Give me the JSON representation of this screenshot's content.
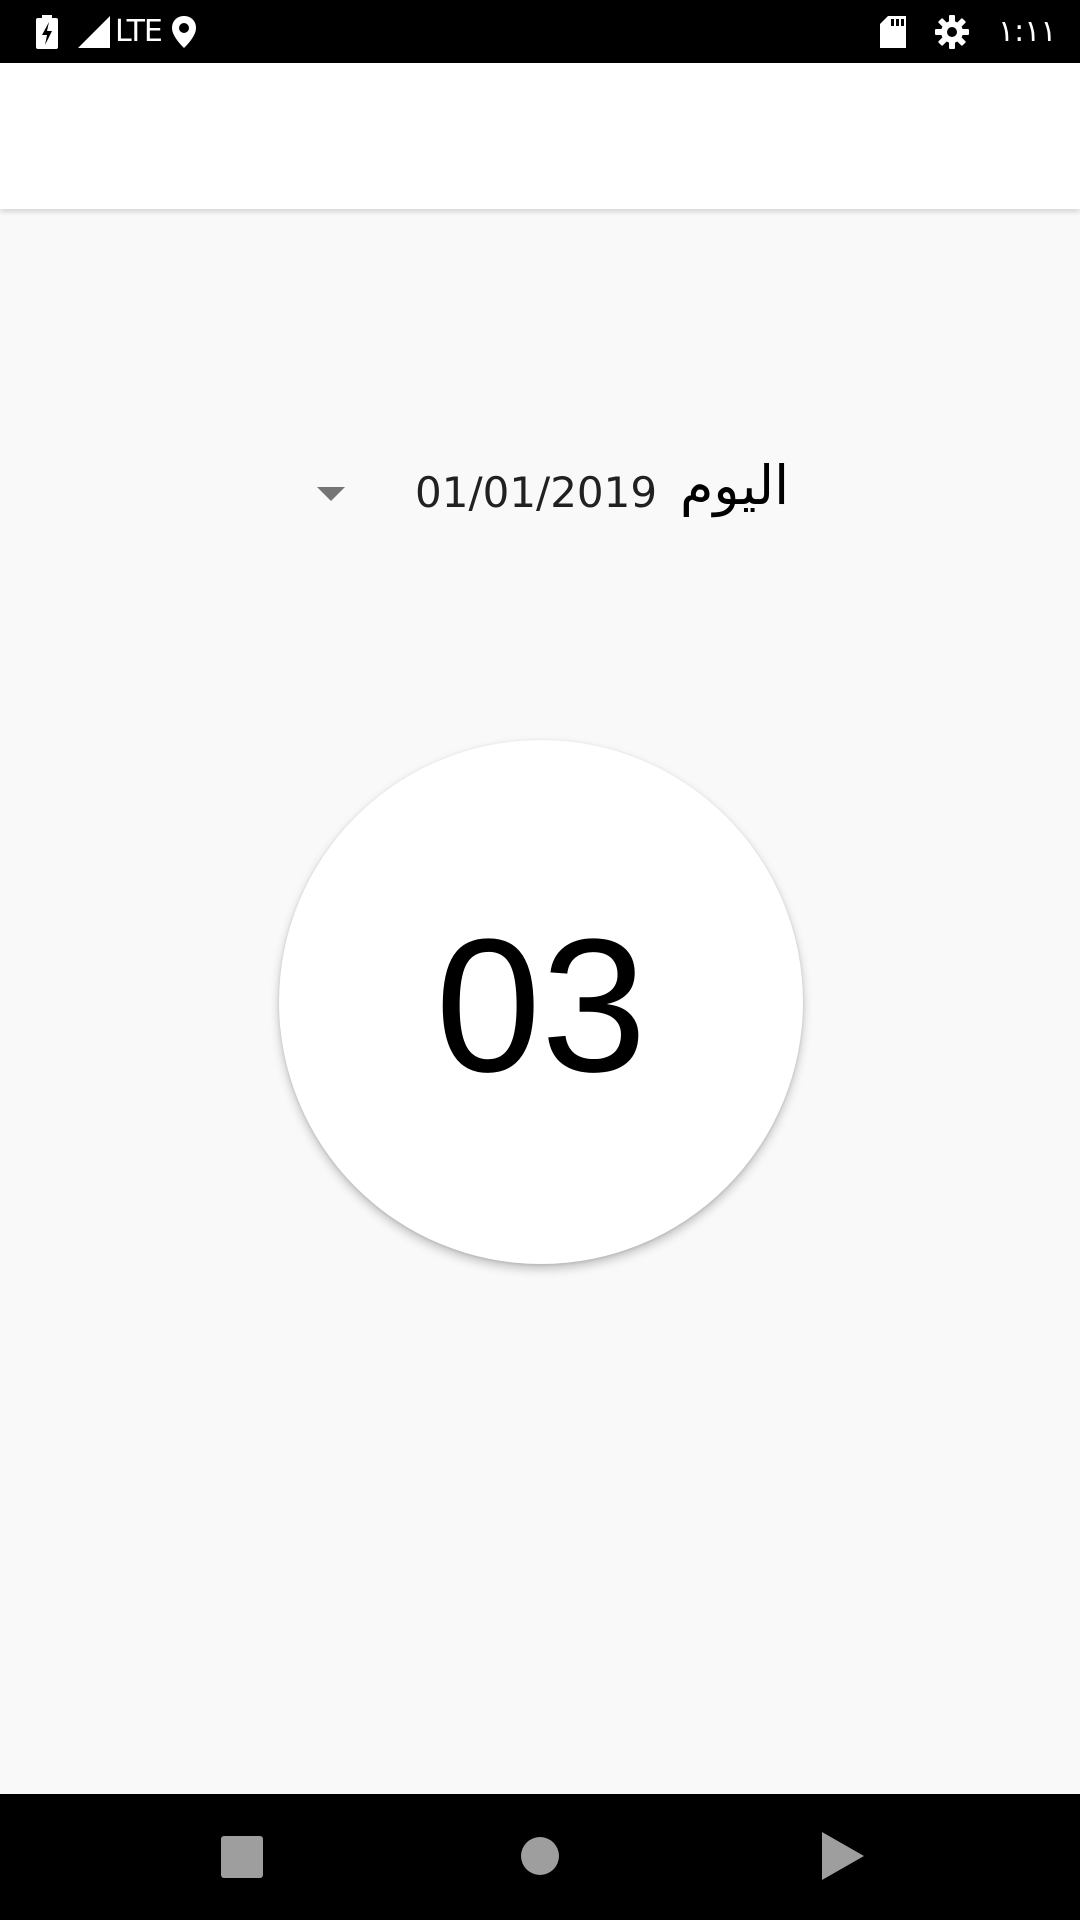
{
  "status_bar": {
    "network": "LTE",
    "time": "١:١١",
    "icons": [
      "battery-charging-icon",
      "signal-icon",
      "location-icon",
      "sd-card-icon",
      "settings-icon"
    ]
  },
  "date_selector": {
    "day_label": "اليوم",
    "date": "01/01/2019"
  },
  "counter": {
    "value": "03"
  },
  "nav_bar": {
    "buttons": [
      "recents-square-icon",
      "home-circle-icon",
      "back-triangle-icon"
    ]
  },
  "colors": {
    "background": "#f9f9f9",
    "app_bar": "#ffffff",
    "system_bars": "#000000",
    "dropdown_arrow": "#757575"
  }
}
